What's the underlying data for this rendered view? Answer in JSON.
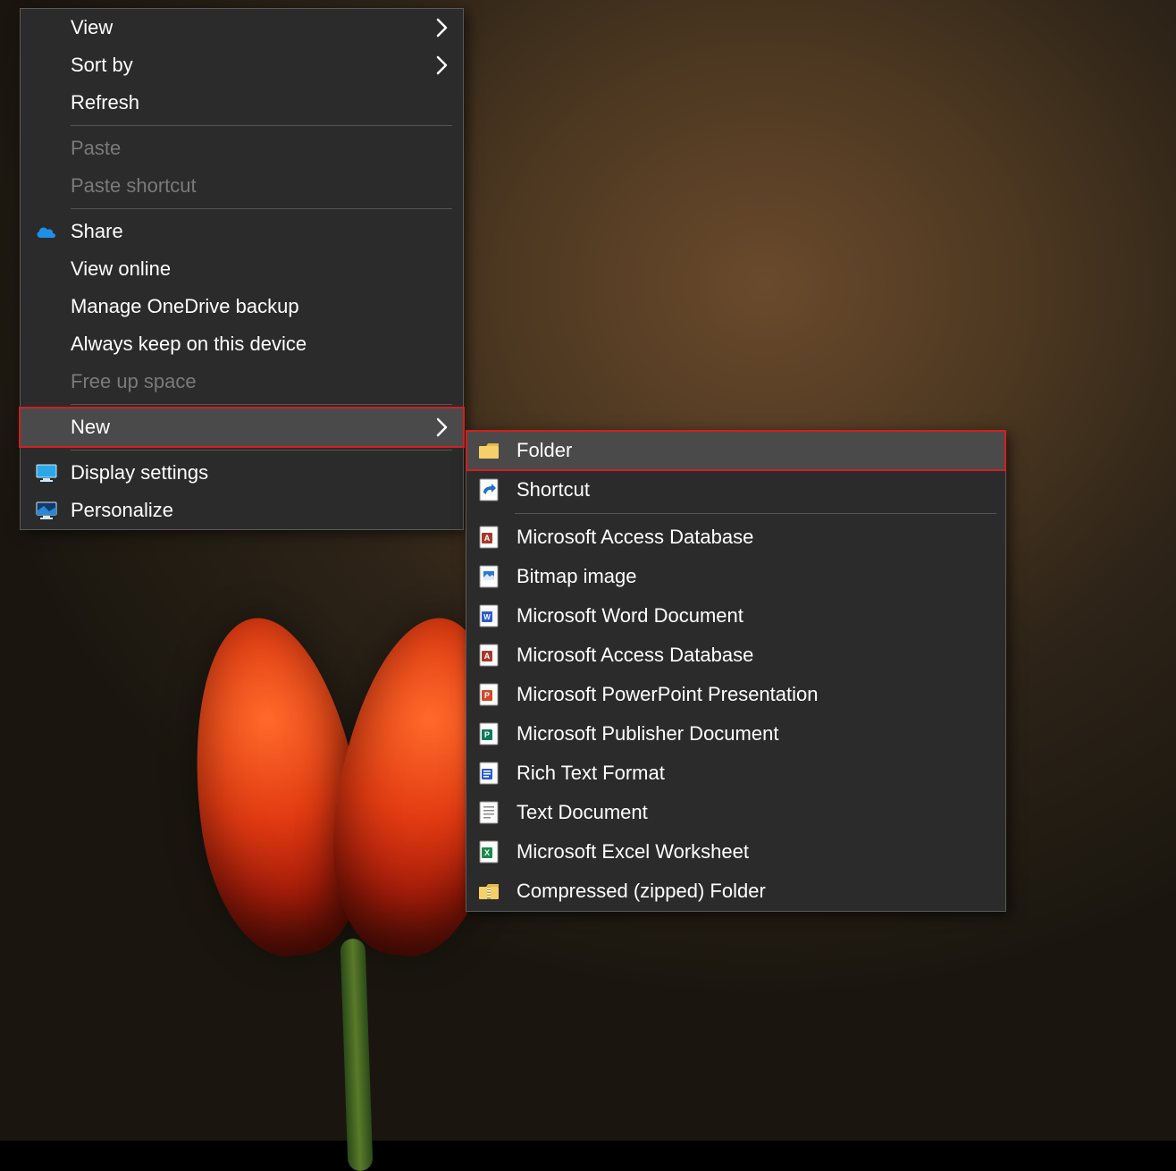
{
  "context_menu": {
    "view": "View",
    "sort_by": "Sort by",
    "refresh": "Refresh",
    "paste": "Paste",
    "paste_shortcut": "Paste shortcut",
    "share": "Share",
    "view_online": "View online",
    "manage_onedrive_backup": "Manage OneDrive backup",
    "always_keep_on_device": "Always keep on this device",
    "free_up_space": "Free up space",
    "new": "New",
    "display_settings": "Display settings",
    "personalize": "Personalize"
  },
  "new_submenu": {
    "folder": "Folder",
    "shortcut": "Shortcut",
    "access_db": "Microsoft Access Database",
    "bitmap": "Bitmap image",
    "word": "Microsoft Word Document",
    "access_db2": "Microsoft Access Database",
    "powerpoint": "Microsoft PowerPoint Presentation",
    "publisher": "Microsoft Publisher Document",
    "rtf": "Rich Text Format",
    "text": "Text Document",
    "excel": "Microsoft Excel Worksheet",
    "zip": "Compressed (zipped) Folder"
  }
}
